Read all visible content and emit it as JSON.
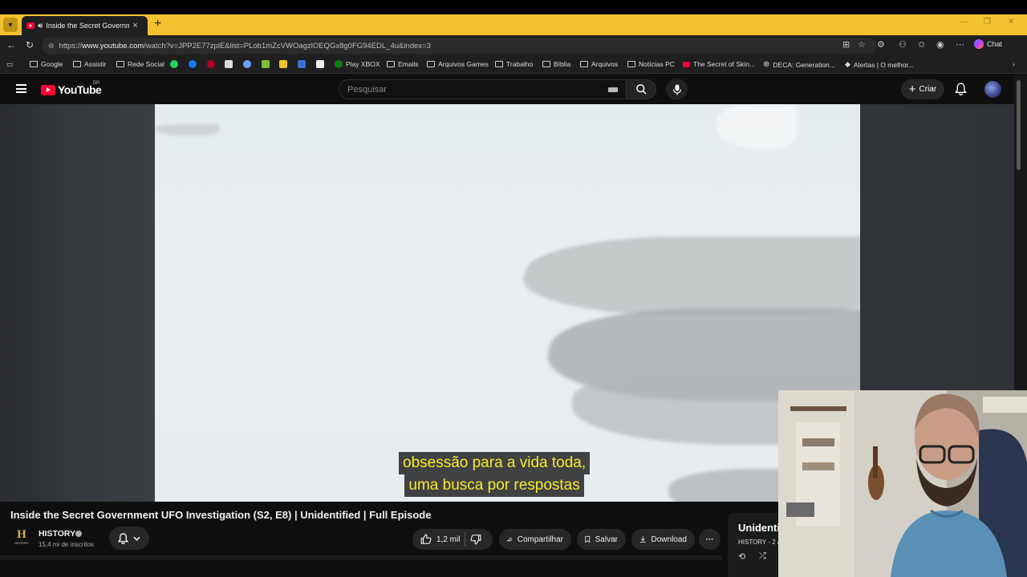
{
  "browser": {
    "tab": {
      "title": "Inside the Secret Government UFO Investigation",
      "close": "×"
    },
    "new_tab": "+",
    "url": {
      "prefix": "https://",
      "host": "www.youtube.com",
      "path": "/watch?v=JPP2E77zplE&list=PLob1mZcVWOagzlOEQGx8g0FG94EDL_4u&index=3"
    },
    "chat_label": "Chat",
    "bookmarks": [
      {
        "label": "Google",
        "icon": "folder"
      },
      {
        "label": "Assistir",
        "icon": "folder"
      },
      {
        "label": "Rede Social",
        "icon": "folder"
      },
      {
        "label": "Play XBOX",
        "icon": "xbox-icon"
      },
      {
        "label": "Emails",
        "icon": "folder"
      },
      {
        "label": "Arquivos Games",
        "icon": "folder"
      },
      {
        "label": "Trabalho",
        "icon": "folder"
      },
      {
        "label": "Bíblia",
        "icon": "folder"
      },
      {
        "label": "Arquivos",
        "icon": "folder"
      },
      {
        "label": "Notícias PC",
        "icon": "folder"
      },
      {
        "label": "The Secret of Skin...",
        "icon": "youtube-icon"
      },
      {
        "label": "DECA: Generation...",
        "icon": "globe-icon"
      },
      {
        "label": "Alertas | O melhor...",
        "icon": "diamond-icon"
      }
    ]
  },
  "youtube": {
    "logo_text": "YouTube",
    "country": "BR",
    "search_placeholder": "Pesquisar",
    "create_label": "Criar",
    "accent": "#ff0033"
  },
  "player": {
    "caption_lines": [
      "obsessão para a vida toda,",
      "uma busca por respostas"
    ],
    "caption_color": "#f7ec2b"
  },
  "video": {
    "title": "Inside the Secret Government UFO Investigation (S2, E8) | Unidentified | Full Episode",
    "channel": {
      "name": "HISTORY",
      "avatar_letter": "H",
      "avatar_sub": "HISTORY",
      "subscribers": "15,4 mi de inscritos"
    },
    "actions": {
      "likes": "1,2 mil",
      "share": "Compartilhar",
      "save": "Salvar",
      "download": "Download",
      "more": "···"
    }
  },
  "playlist_panel": {
    "title": "Unidenti",
    "subtitle": "HISTORY - 2 /"
  }
}
